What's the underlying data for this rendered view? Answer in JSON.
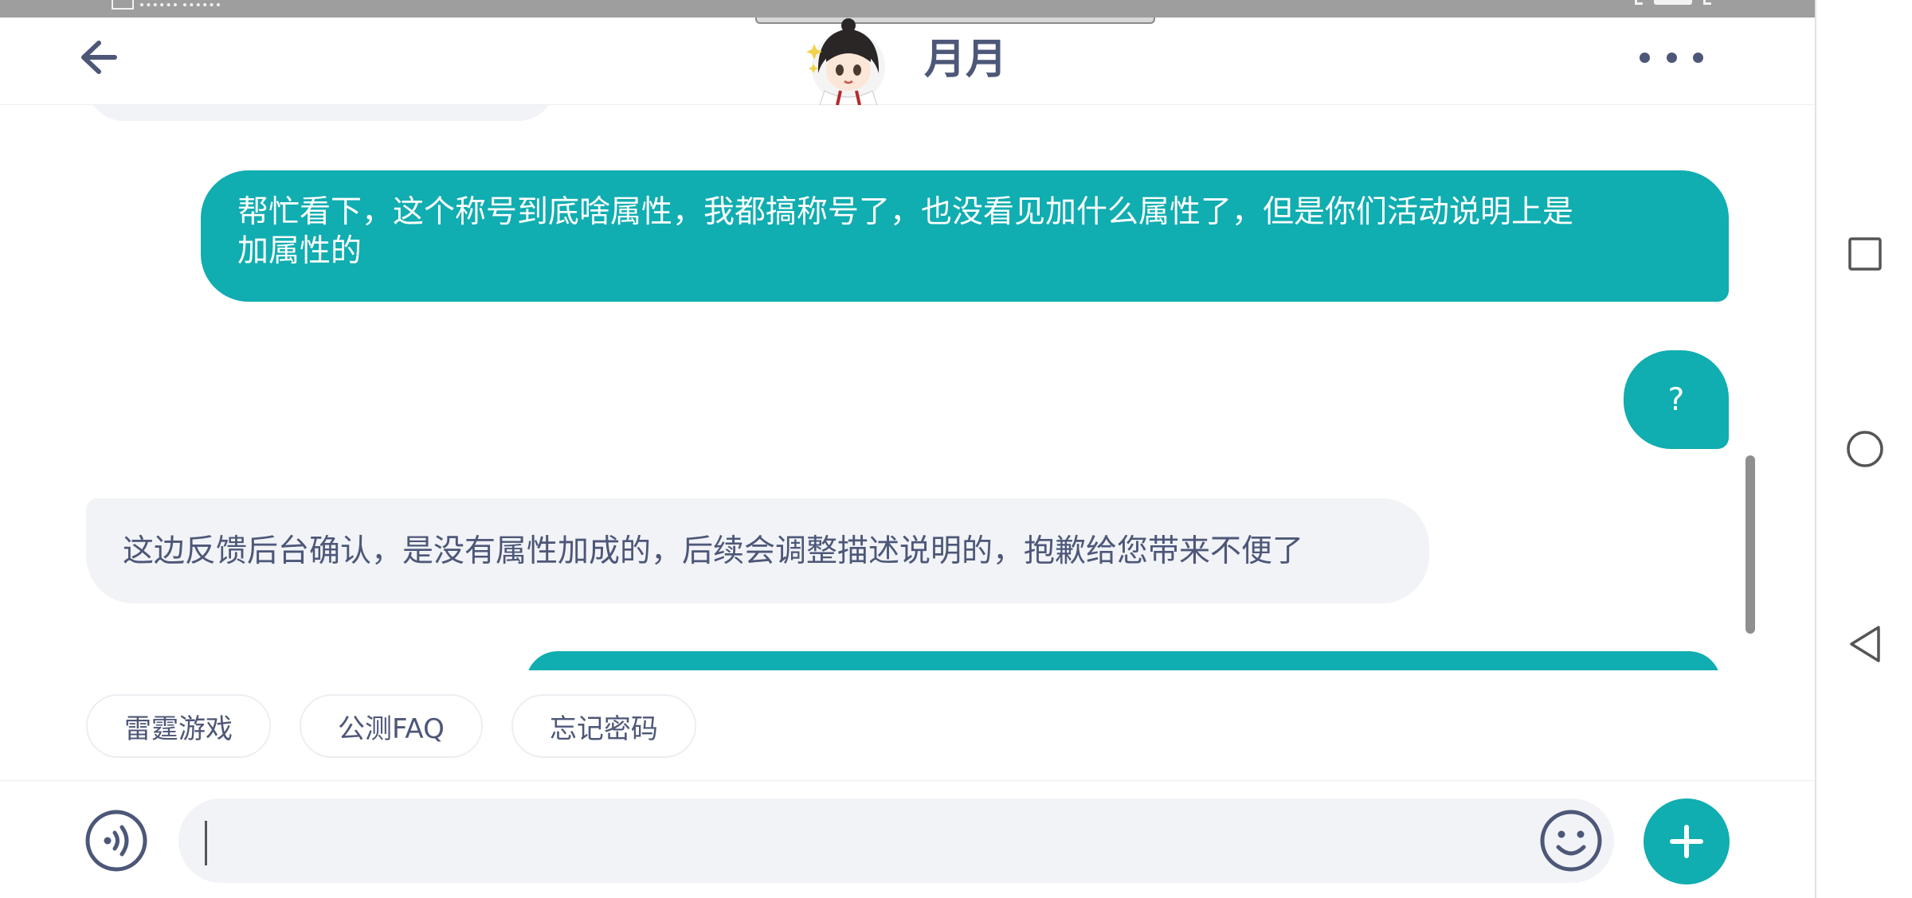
{
  "header": {
    "title": "月月",
    "back_icon": "arrow-left-icon",
    "more_icon": "more-dots-icon"
  },
  "messages": [
    {
      "direction": "outgoing",
      "text": "帮忙看下，这个称号到底啥属性，我都搞称号了，也没看见加什么属性了，但是你们活动说明上是\n加属性的"
    },
    {
      "direction": "outgoing",
      "text": "?"
    },
    {
      "direction": "incoming",
      "text": "这边反馈后台确认，是没有属性加成的，后续会调整描述说明的，抱歉给您带来不便了"
    }
  ],
  "quick_replies": [
    {
      "label": "雷霆游戏"
    },
    {
      "label": "公测FAQ"
    },
    {
      "label": "忘记密码"
    }
  ],
  "input": {
    "value": "",
    "placeholder": ""
  },
  "icons": {
    "voice": "voice-wave-icon",
    "emoji": "emoji-smile-icon",
    "plus": "plus-icon",
    "nav_recent": "square-icon",
    "nav_home": "circle-icon",
    "nav_back": "triangle-back-icon"
  },
  "colors": {
    "accent": "#10adb1",
    "incoming_bubble": "#f1f3f7",
    "text_dark": "#4d5778"
  }
}
